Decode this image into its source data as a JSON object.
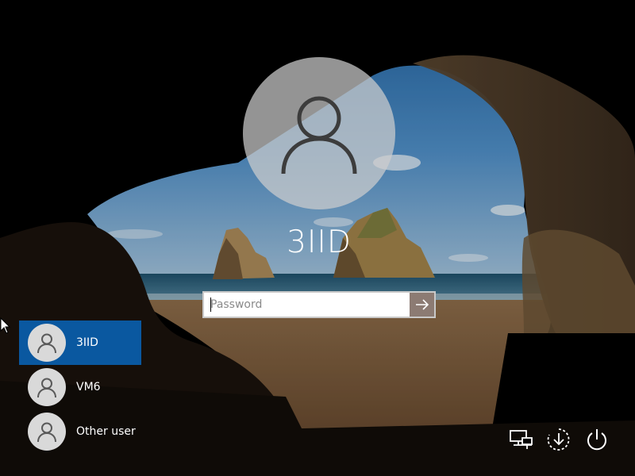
{
  "lockscreen": {
    "username": "3IID",
    "password_placeholder": "Password"
  },
  "users": [
    {
      "label": "3IID",
      "selected": true
    },
    {
      "label": "VM6",
      "selected": false
    },
    {
      "label": "Other user",
      "selected": false
    }
  ],
  "system_buttons": [
    {
      "icon": "network-icon"
    },
    {
      "icon": "ease-of-access-icon"
    },
    {
      "icon": "power-icon"
    }
  ],
  "colors": {
    "selected_user_bg": "#0a58a0",
    "text": "#ffffff"
  }
}
